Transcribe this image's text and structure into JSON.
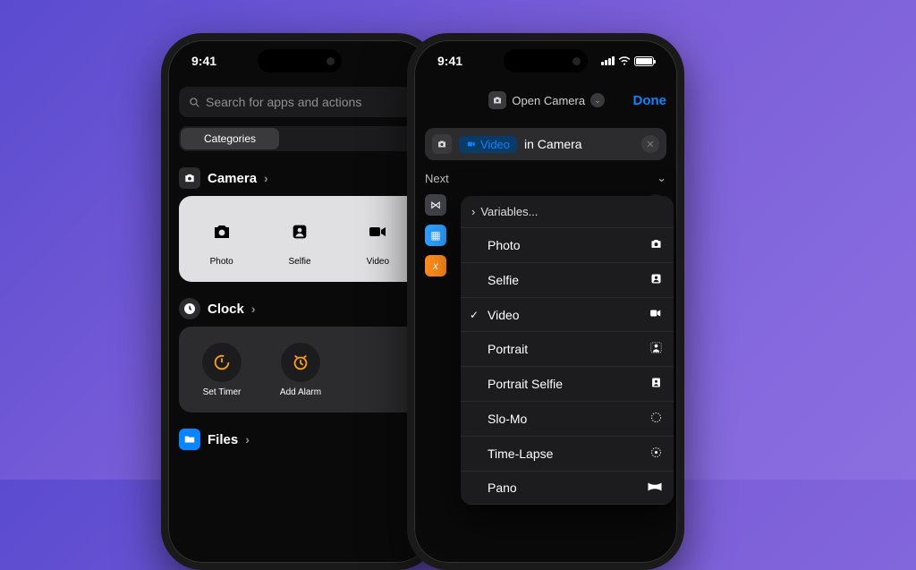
{
  "status_time": "9:41",
  "left": {
    "search_placeholder": "Search for apps and actions",
    "seg_label": "Categories",
    "camera": {
      "title": "Camera",
      "items": [
        {
          "label": "Photo",
          "icon": "camera-icon"
        },
        {
          "label": "Selfie",
          "icon": "selfie-icon"
        },
        {
          "label": "Video",
          "icon": "video-icon"
        }
      ]
    },
    "clock": {
      "title": "Clock",
      "items": [
        {
          "label": "Set Timer",
          "icon": "timer-icon"
        },
        {
          "label": "Add Alarm",
          "icon": "alarm-icon"
        }
      ]
    },
    "files": {
      "title": "Files"
    }
  },
  "right": {
    "nav_title": "Open Camera",
    "done": "Done",
    "action": {
      "prefix": "",
      "token": "Video",
      "suffix": "in Camera"
    },
    "next_label": "Next",
    "list": [
      {
        "color": "#414148"
      },
      {
        "color": "#2aa0ff"
      },
      {
        "color": "#ff8c1a"
      }
    ],
    "popover": {
      "header": "Variables...",
      "options": [
        {
          "label": "Photo",
          "icon": "camera-icon",
          "checked": false
        },
        {
          "label": "Selfie",
          "icon": "selfie-icon",
          "checked": false
        },
        {
          "label": "Video",
          "icon": "video-icon",
          "checked": true
        },
        {
          "label": "Portrait",
          "icon": "portrait-icon",
          "checked": false
        },
        {
          "label": "Portrait Selfie",
          "icon": "portrait-selfie-icon",
          "checked": false
        },
        {
          "label": "Slo-Mo",
          "icon": "slomo-icon",
          "checked": false
        },
        {
          "label": "Time-Lapse",
          "icon": "timelapse-icon",
          "checked": false
        },
        {
          "label": "Pano",
          "icon": "pano-icon",
          "checked": false
        }
      ]
    }
  }
}
